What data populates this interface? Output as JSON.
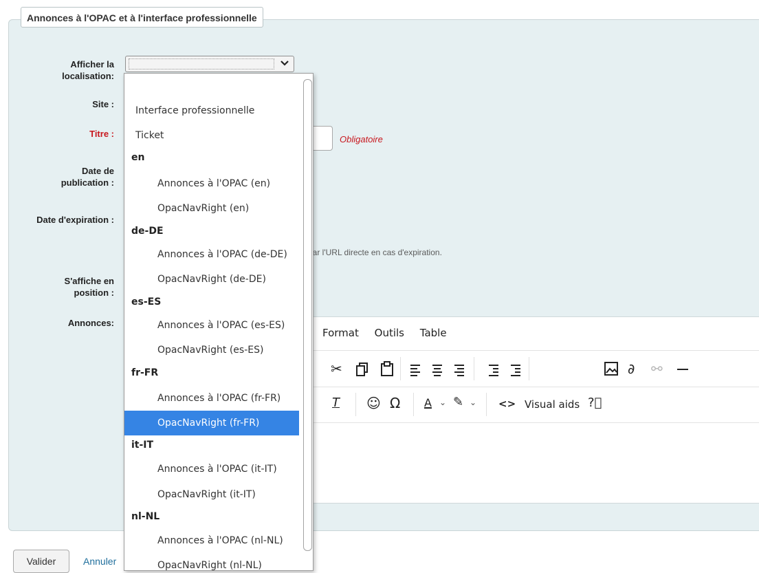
{
  "fieldset": {
    "legend": "Annonces à l'OPAC et à l'interface professionnelle"
  },
  "labels": {
    "location": "Afficher la localisation:",
    "site": "Site :",
    "title": "Titre :",
    "publication_date": "Date de publication :",
    "expiration_date": "Date d'expiration :",
    "position": "S'affiche en position :",
    "content": "Annonces:"
  },
  "title_field": {
    "required_note": "Obligatoire"
  },
  "expiration_hint": "par l'URL directe en cas d'expiration.",
  "editor": {
    "menu": [
      "Format",
      "Outils",
      "Table"
    ],
    "visual_aids": "Visual aids",
    "colors": {
      "accent": "#3584e4"
    }
  },
  "dropdown": {
    "items": [
      {
        "kind": "option",
        "label": "Interface professionnelle"
      },
      {
        "kind": "option",
        "label": "Ticket"
      },
      {
        "kind": "group",
        "label": "en"
      },
      {
        "kind": "option",
        "label": "Annonces à l'OPAC (en)"
      },
      {
        "kind": "option",
        "label": "OpacNavRight (en)"
      },
      {
        "kind": "group",
        "label": "de-DE"
      },
      {
        "kind": "option",
        "label": "Annonces à l'OPAC (de-DE)"
      },
      {
        "kind": "option",
        "label": "OpacNavRight (de-DE)"
      },
      {
        "kind": "group",
        "label": "es-ES"
      },
      {
        "kind": "option",
        "label": "Annonces à l'OPAC (es-ES)"
      },
      {
        "kind": "option",
        "label": "OpacNavRight (es-ES)"
      },
      {
        "kind": "group",
        "label": "fr-FR"
      },
      {
        "kind": "option",
        "label": "Annonces à l'OPAC (fr-FR)"
      },
      {
        "kind": "option",
        "label": "OpacNavRight (fr-FR)",
        "highlighted": true
      },
      {
        "kind": "group",
        "label": "it-IT"
      },
      {
        "kind": "option",
        "label": "Annonces à l'OPAC (it-IT)"
      },
      {
        "kind": "option",
        "label": "OpacNavRight (it-IT)"
      },
      {
        "kind": "group",
        "label": "nl-NL"
      },
      {
        "kind": "option",
        "label": "Annonces à l'OPAC (nl-NL)"
      },
      {
        "kind": "option",
        "label": "OpacNavRight (nl-NL)"
      }
    ]
  },
  "footer": {
    "submit": "Valider",
    "cancel": "Annuler"
  }
}
